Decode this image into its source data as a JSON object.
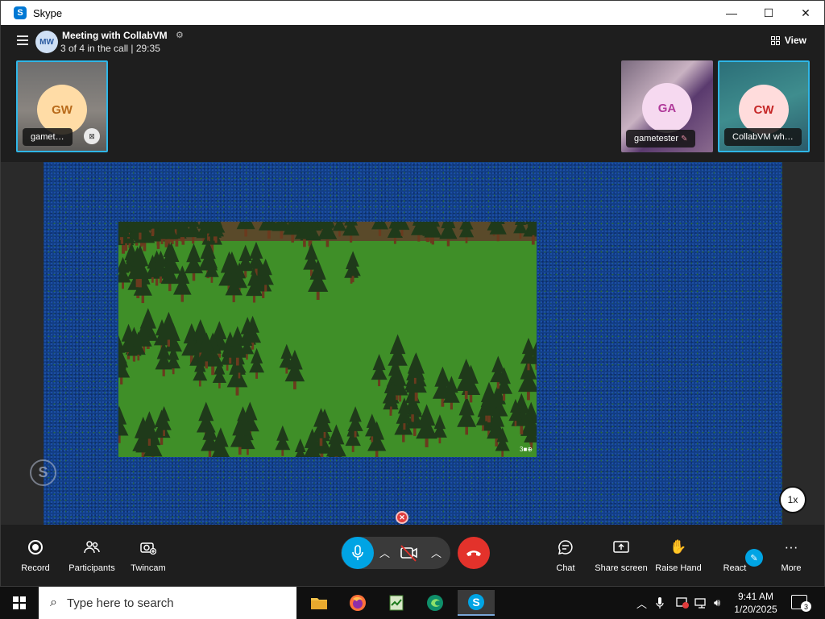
{
  "window": {
    "title": "Skype",
    "min_glyph": "—",
    "max_glyph": "☐",
    "close_glyph": "✕"
  },
  "header": {
    "avatar_initials": "MW",
    "meeting_title": "Meeting with CollabVM",
    "status": "3 of 4 in the call | 29:35",
    "view_label": "View"
  },
  "participants": [
    {
      "initials": "GW",
      "name": "gamet…",
      "avatar_bg": "#ffdca6",
      "avatar_fg": "#b86a1a"
    },
    {
      "initials": "GA",
      "name": "gametester",
      "avatar_bg": "#f6d9f0",
      "avatar_fg": "#b03a9a"
    },
    {
      "initials": "CW",
      "name": "CollabVM wh…",
      "avatar_bg": "#ffdcdc",
      "avatar_fg": "#c62828"
    }
  ],
  "screen": {
    "game_watermark": "3■⊕",
    "speed": "1x",
    "skype_watermark": "S"
  },
  "controls": {
    "record": "Record",
    "participants": "Participants",
    "twincam": "Twincam",
    "chat": "Chat",
    "share": "Share screen",
    "raise": "Raise Hand",
    "react": "React",
    "more": "More"
  },
  "taskbar": {
    "search_placeholder": "Type here to search",
    "time": "9:41 AM",
    "date": "1/20/2025",
    "notifications": "3"
  },
  "colors": {
    "accent": "#00a4e4",
    "hangup": "#e3322b",
    "active_border": "#2fb6e7",
    "game_grass": "#3b8a25",
    "water": "#123e86"
  }
}
